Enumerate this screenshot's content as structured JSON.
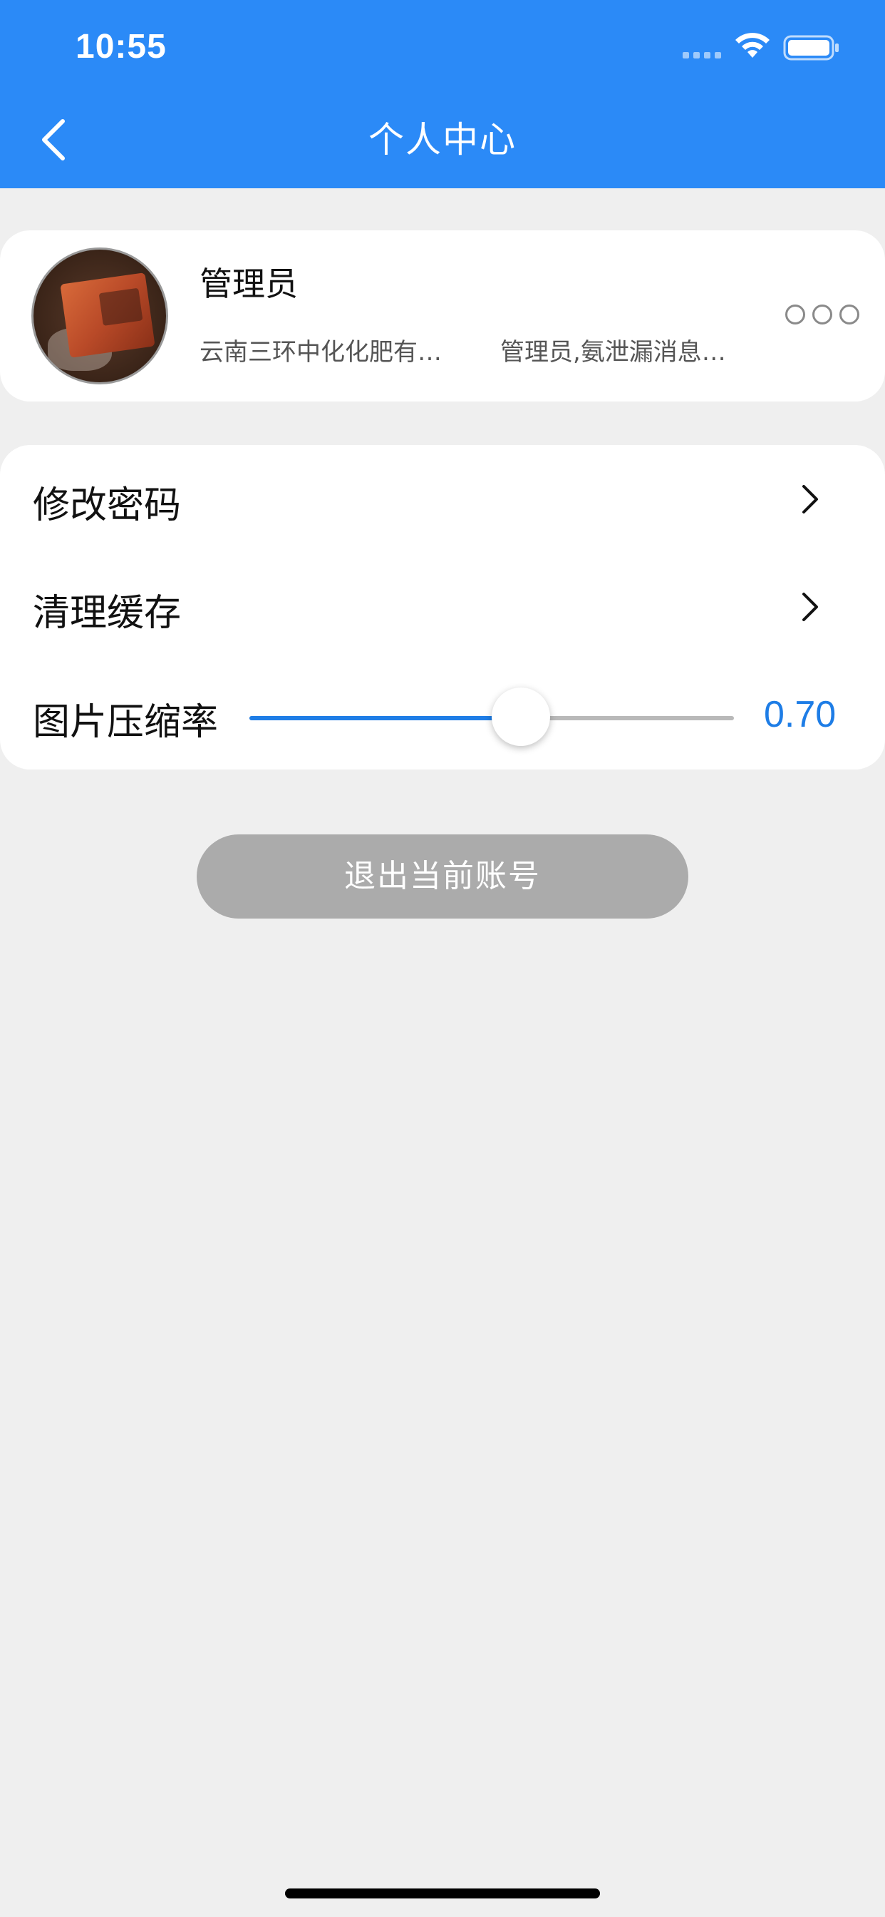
{
  "status_bar": {
    "time": "10:55"
  },
  "nav": {
    "title": "个人中心",
    "back_icon": "chevron-left-icon"
  },
  "profile": {
    "name": "管理员",
    "organization": "云南三环中化化肥有…",
    "roles": "管理员,氨泄漏消息…",
    "more_icon": "more-dots-icon"
  },
  "settings": {
    "change_password": "修改密码",
    "clear_cache": "清理缓存",
    "compression_label": "图片压缩率",
    "compression_value": "0.70",
    "compression_level": 0.56
  },
  "logout": {
    "label": "退出当前账号"
  },
  "colors": {
    "header_bg": "#2b8af7",
    "accent": "#1e7de6",
    "page_bg": "#efefef",
    "logout_bg": "#ababab"
  }
}
